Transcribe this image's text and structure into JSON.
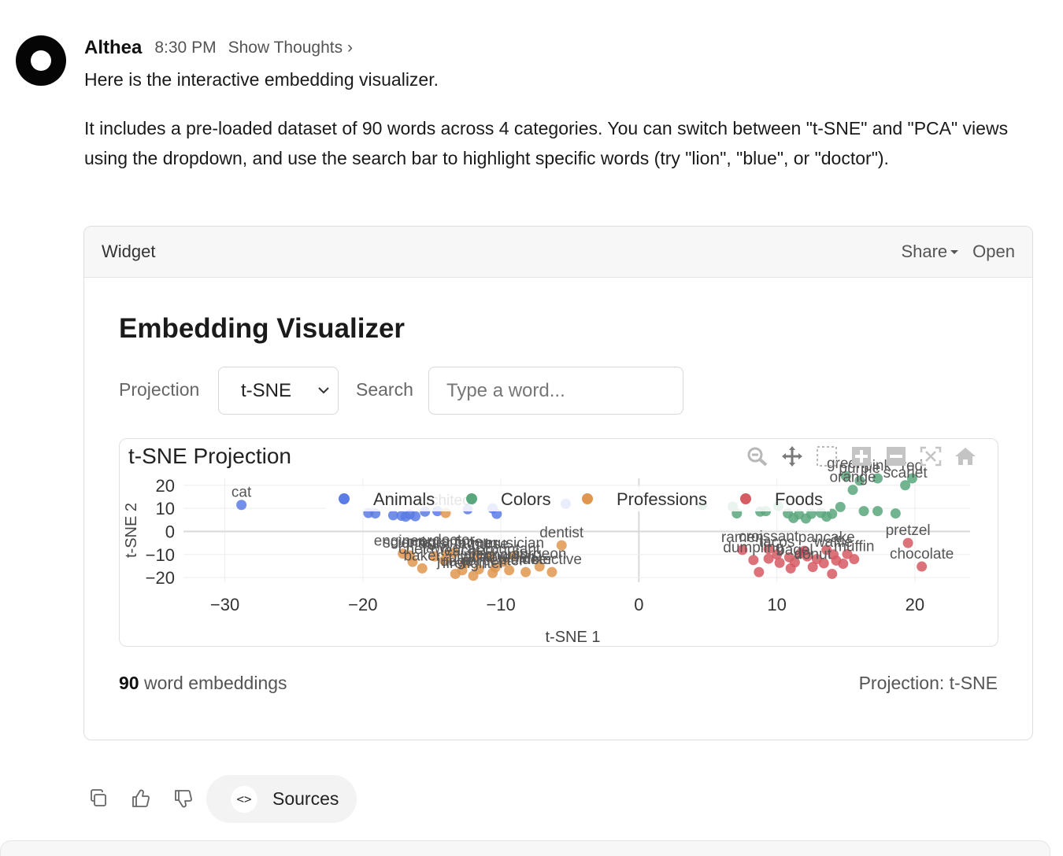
{
  "message": {
    "sender": "Althea",
    "time": "8:30 PM",
    "show_thoughts": "Show Thoughts ›",
    "line1": "Here is the interactive embedding visualizer.",
    "line2": "It includes a pre-loaded dataset of 90 words across 4 categories. You can switch between \"t-SNE\" and \"PCA\" views using the dropdown, and use the search bar to highlight specific words (try \"lion\", \"blue\", or \"doctor\")."
  },
  "widget": {
    "title": "Widget",
    "share_label": "Share",
    "open_label": "Open",
    "heading": "Embedding Visualizer",
    "projection_label": "Projection",
    "projection_value": "t-SNE",
    "search_label": "Search",
    "search_placeholder": "Type a word...",
    "count": "90",
    "count_suffix": " word embeddings",
    "footer_projection": "Projection: t-SNE"
  },
  "modebar_icons": [
    "zoom-icon",
    "pan-icon",
    "box-select-icon",
    "zoom-in-icon",
    "zoom-out-icon",
    "autoscale-icon",
    "reset-axes-icon"
  ],
  "chart_data": {
    "type": "scatter",
    "title": "t-SNE Projection",
    "xlabel": "t-SNE 1",
    "ylabel": "t-SNE 2",
    "xlim": [
      -33,
      24
    ],
    "ylim": [
      -22,
      23
    ],
    "xticks": [
      -30,
      -20,
      -10,
      0,
      10,
      20
    ],
    "yticks": [
      20,
      10,
      0,
      -10,
      -20
    ],
    "legend_position": "top",
    "grid": true,
    "series": [
      {
        "name": "Animals",
        "color": "#5b7be6",
        "points": [
          {
            "x": -28.8,
            "y": 11.5,
            "label": "cat"
          },
          {
            "x": -19.6,
            "y": 8.0
          },
          {
            "x": -19.1,
            "y": 7.8
          },
          {
            "x": -17.8,
            "y": 7.0
          },
          {
            "x": -17.2,
            "y": 6.8
          },
          {
            "x": -16.9,
            "y": 6.4
          },
          {
            "x": -16.6,
            "y": 7.4
          },
          {
            "x": -16.2,
            "y": 6.6
          },
          {
            "x": -15.5,
            "y": 8.6
          },
          {
            "x": -14.6,
            "y": 8.8
          },
          {
            "x": -12.4,
            "y": 9.6
          },
          {
            "x": -10.6,
            "y": 10.0
          },
          {
            "x": -10.3,
            "y": 7.6
          },
          {
            "x": -5.3,
            "y": 12.0
          }
        ]
      },
      {
        "name": "Colors",
        "color": "#5aa77d",
        "points": [
          {
            "x": 4.6,
            "y": 11.5
          },
          {
            "x": 6.8,
            "y": 10.8
          },
          {
            "x": 7.1,
            "y": 7.8
          },
          {
            "x": 8.8,
            "y": 8.6
          },
          {
            "x": 9.2,
            "y": 8.8
          },
          {
            "x": 10.1,
            "y": 11.0
          },
          {
            "x": 10.8,
            "y": 7.8
          },
          {
            "x": 11.2,
            "y": 5.8
          },
          {
            "x": 11.6,
            "y": 7.4
          },
          {
            "x": 12.1,
            "y": 5.6
          },
          {
            "x": 12.5,
            "y": 7.6
          },
          {
            "x": 13.2,
            "y": 8.0
          },
          {
            "x": 13.6,
            "y": 6.4
          },
          {
            "x": 14.0,
            "y": 7.6
          },
          {
            "x": 14.6,
            "y": 10.6
          },
          {
            "x": 16.3,
            "y": 8.8
          },
          {
            "x": 17.3,
            "y": 8.8
          },
          {
            "x": 18.6,
            "y": 7.8
          },
          {
            "x": 19.3,
            "y": 20.0,
            "label": "scarlet"
          },
          {
            "x": 19.8,
            "y": 23.0,
            "label": "red"
          },
          {
            "x": 17.3,
            "y": 23.0,
            "label": "pink"
          },
          {
            "x": 16.0,
            "y": 22.0,
            "label": "purple"
          },
          {
            "x": 15.5,
            "y": 18.0,
            "label": "orange"
          },
          {
            "x": 15.0,
            "y": 24.0,
            "label": "green"
          }
        ]
      },
      {
        "name": "Professions",
        "color": "#e0964f",
        "points": [
          {
            "x": -14.0,
            "y": 8.0,
            "label": "architect"
          },
          {
            "x": -5.6,
            "y": -6.0,
            "label": "dentist"
          },
          {
            "x": -17.1,
            "y": -9.6,
            "label": "engineer"
          },
          {
            "x": -16.6,
            "y": -10.4,
            "label": "scientist"
          },
          {
            "x": -14.8,
            "y": -10.8,
            "label": "artist"
          },
          {
            "x": -13.4,
            "y": -9.2,
            "label": "doctor"
          },
          {
            "x": -11.8,
            "y": -10.6,
            "label": "farmer"
          },
          {
            "x": -9.8,
            "y": -13.2,
            "label": "accountant"
          },
          {
            "x": -14.1,
            "y": -12.6,
            "label": "lawyer"
          },
          {
            "x": -12.6,
            "y": -13.8,
            "label": "teacher"
          },
          {
            "x": -9.0,
            "y": -10.6,
            "label": "musician"
          },
          {
            "x": -8.2,
            "y": -17.6,
            "label": "plumber"
          },
          {
            "x": -16.4,
            "y": -13.2,
            "label": "chef"
          },
          {
            "x": -10.8,
            "y": -11.0,
            "label": "nurse"
          },
          {
            "x": -12.8,
            "y": -16.8,
            "label": "pilot"
          },
          {
            "x": -11.6,
            "y": -16.4,
            "label": "writer"
          },
          {
            "x": -15.7,
            "y": -16.0,
            "label": "baker"
          },
          {
            "x": -13.3,
            "y": -18.4,
            "label": "judge"
          },
          {
            "x": -12.0,
            "y": -19.2,
            "label": "firefighter"
          },
          {
            "x": -10.4,
            "y": -15.6,
            "label": "mechanic"
          },
          {
            "x": -9.4,
            "y": -16.8,
            "label": "librarian"
          },
          {
            "x": -7.2,
            "y": -15.2,
            "label": "surgeon"
          },
          {
            "x": -6.3,
            "y": -17.6,
            "label": "detective"
          },
          {
            "x": -10.6,
            "y": -18.0,
            "label": "carpenter"
          },
          {
            "x": -13.9,
            "y": -10.0,
            "label": "programmer"
          }
        ]
      },
      {
        "name": "Foods",
        "color": "#d65b63",
        "points": [
          {
            "x": 19.5,
            "y": -5.0,
            "label": "pretzel"
          },
          {
            "x": 20.5,
            "y": -15.2,
            "label": "chocolate"
          },
          {
            "x": 7.5,
            "y": -8.0,
            "label": "ramen"
          },
          {
            "x": 9.4,
            "y": -7.6,
            "label": "croissant"
          },
          {
            "x": 10.0,
            "y": -10.0,
            "label": "tacos"
          },
          {
            "x": 8.3,
            "y": -12.4,
            "label": "dumpling"
          },
          {
            "x": 11.3,
            "y": -13.4,
            "label": "bagel"
          },
          {
            "x": 12.6,
            "y": -15.4,
            "label": "donut"
          },
          {
            "x": 13.6,
            "y": -8.0,
            "label": "pancake"
          },
          {
            "x": 14.1,
            "y": -10.0,
            "label": "waffle"
          },
          {
            "x": 15.6,
            "y": -12.0,
            "label": "muffin"
          },
          {
            "x": 9.4,
            "y": -11.8
          },
          {
            "x": 10.2,
            "y": -13.6
          },
          {
            "x": 10.9,
            "y": -11.2
          },
          {
            "x": 11.7,
            "y": -9.6
          },
          {
            "x": 12.2,
            "y": -10.8
          },
          {
            "x": 12.9,
            "y": -12.0
          },
          {
            "x": 13.4,
            "y": -13.8
          },
          {
            "x": 14.3,
            "y": -12.6
          },
          {
            "x": 15.1,
            "y": -9.8
          },
          {
            "x": 11.0,
            "y": -16.0
          },
          {
            "x": 8.7,
            "y": -17.6
          },
          {
            "x": 14.0,
            "y": -18.4
          },
          {
            "x": 12.0,
            "y": -8.4
          },
          {
            "x": 14.8,
            "y": -14.0
          }
        ]
      }
    ]
  },
  "actions": {
    "sources_label": "Sources"
  }
}
